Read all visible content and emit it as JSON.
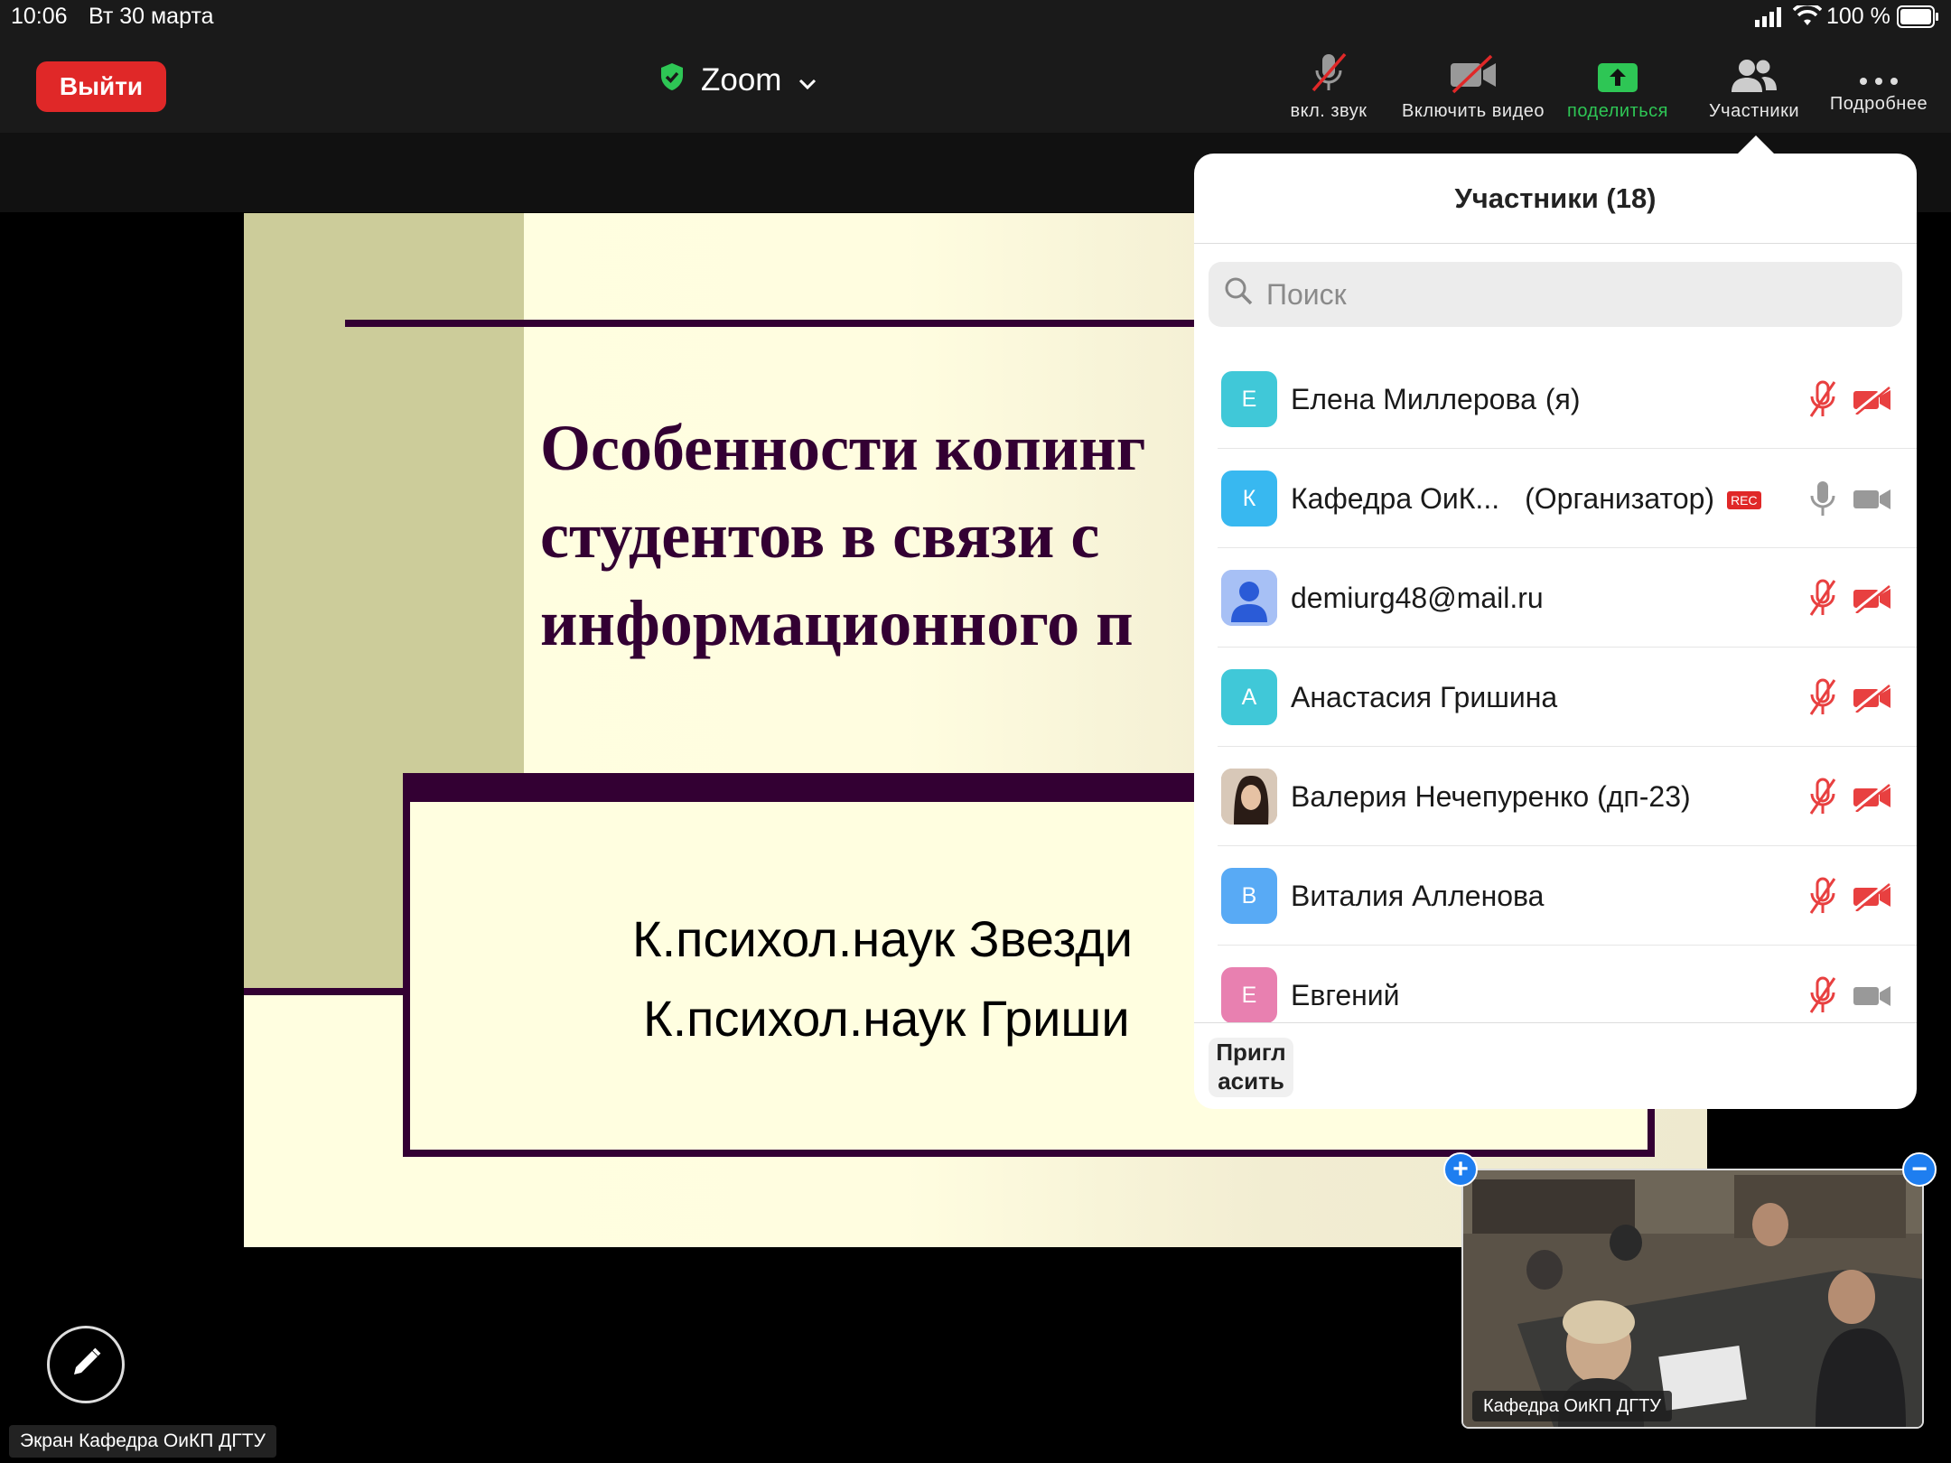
{
  "status_bar": {
    "time": "10:06",
    "date": "Вт 30 марта",
    "battery": "100 %"
  },
  "toolbar": {
    "exit_label": "Выйти",
    "title": "Zoom",
    "items": [
      {
        "label": "вкл. звук",
        "icon": "mic-off-icon"
      },
      {
        "label": "Включить видео",
        "icon": "video-off-icon"
      },
      {
        "label": "поделиться",
        "icon": "share-icon",
        "color": "#2ec655"
      },
      {
        "label": "Участники",
        "icon": "participants-icon"
      },
      {
        "label": "Подробнее",
        "icon": "more-icon"
      }
    ]
  },
  "slide": {
    "title_lines": [
      "Особенности копинг",
      "студентов  в связи с",
      "информационного п"
    ],
    "author_lines": [
      "К.психол.наук  Звезди",
      "К.психол.наук Гриши"
    ]
  },
  "screen_label": "Экран Кафедра ОиКП ДГТУ",
  "video_label": "Кафедра ОиКП ДГТУ",
  "participants": {
    "title": "Участники (18)",
    "search_placeholder": "Поиск",
    "invite_label": "Пригл асить",
    "list": [
      {
        "initial": "Е",
        "name": "Елена Миллерова",
        "suffix": "(я)",
        "color": "#40c8d8",
        "mic": "off",
        "cam": "off"
      },
      {
        "initial": "К",
        "name": "Кафедра ОиК...",
        "suffix": "(Организатор)",
        "badge": "REC",
        "color": "#38b8f0",
        "mic": "on",
        "cam": "on"
      },
      {
        "initial": "",
        "name": "demiurg48@mail.ru",
        "suffix": "",
        "color": "#9fb8f0",
        "mic": "off",
        "cam": "off",
        "avatar_type": "person"
      },
      {
        "initial": "А",
        "name": "Анастасия Гришина",
        "suffix": "",
        "color": "#40c8d8",
        "mic": "off",
        "cam": "off"
      },
      {
        "initial": "",
        "name": "Валерия Нечепуренко (дп-23)",
        "suffix": "",
        "color": "#c8a890",
        "mic": "off",
        "cam": "off",
        "avatar_type": "photo"
      },
      {
        "initial": "В",
        "name": "Виталия Алленова",
        "suffix": "",
        "color": "#58aaf5",
        "mic": "off",
        "cam": "off"
      },
      {
        "initial": "Е",
        "name": "Евгений",
        "suffix": "",
        "color": "#e880b0",
        "mic": "off",
        "cam": "on"
      }
    ]
  },
  "colors": {
    "danger": "#e02828",
    "accent_green": "#2ec655",
    "slide_text": "#330033"
  }
}
